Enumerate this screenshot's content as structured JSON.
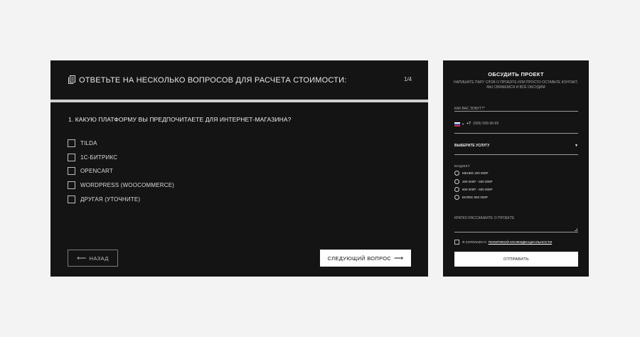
{
  "quiz": {
    "title": "ОТВЕТЬТЕ НА НЕСКОЛЬКО ВОПРОСОВ ДЛЯ РАСЧЕТА СТОИМОСТИ:",
    "counter": "1/4",
    "question": "1. КАКУЮ ПЛАТФОРМУ ВЫ ПРЕДПОЧИТАЕТЕ ДЛЯ ИНТЕРНЕТ-МАГАЗИНА?",
    "options": [
      {
        "label": "TILDA",
        "checked": false
      },
      {
        "label": "1С-БИТРИКС",
        "checked": false
      },
      {
        "label": "OPENCART",
        "checked": false
      },
      {
        "label": "WORDPRESS (WOOCOMMERCE)",
        "checked": false
      },
      {
        "label": "ДРУГАЯ (УТОЧНИТЕ)",
        "checked": false
      }
    ],
    "back_label": "НАЗАД",
    "next_label": "СЛЕДУЮЩИЙ ВОПРОС",
    "back_arrow": "⟵",
    "next_arrow": "⟶"
  },
  "contact": {
    "title": "ОБСУДИТЬ ПРОЕКТ",
    "subtitle": "НАПИШИТЕ ПАРУ СЛОВ О ПРОЕКТЕ ИЛИ ПРОСТО ОСТАВЬТЕ КОНТАКТ, МЫ СВЯЖЕМСЯ И ВСЁ ОБСУДИМ",
    "name_placeholder": "КАК ВАС ЗОВУТ?*",
    "phone_code": "+7",
    "phone_placeholder": "(999) 999-99-99",
    "service_label": "ВЫБЕРИТЕ УСЛУГУ",
    "budget_label": "БЮДЖЕТ",
    "budget_options": [
      "МЕНЕЕ 200 000Р",
      "200 000Р - 600 000Р",
      "600 000Р - 900 000Р",
      "БОЛЕЕ 900 000Р"
    ],
    "about_placeholder": "КРАТКО РАССКАЖИТЕ О ПРОЕКТЕ",
    "agree_text": "Я СОГЛАСЕН С",
    "agree_link": "ПОЛИТИКОЙ КОНФИДЕНЦИАЛЬНОСТИ",
    "submit_label": "ОТПРАВИТЬ"
  },
  "colors": {
    "panel_bg": "#141414",
    "page_bg": "#f3f3f3",
    "button_bg": "#ffffff",
    "flag_white": "#ffffff",
    "flag_blue": "#2350b8",
    "flag_red": "#d5282f"
  },
  "icons": {
    "title_icon": "document-icon",
    "country_flag": "russia-flag-icon",
    "select_arrow": "caret-down-icon"
  }
}
